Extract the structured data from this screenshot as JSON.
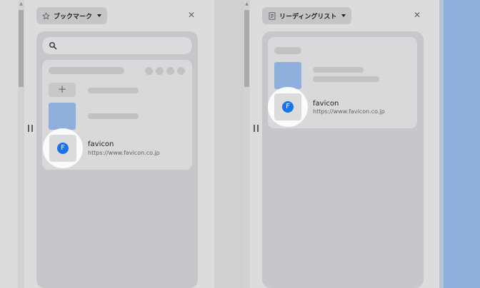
{
  "left_panel": {
    "dropdown_label": "ブックマーク",
    "close_glyph": "✕",
    "add_glyph": "+",
    "favicon_letter": "F",
    "item_title": "favicon",
    "item_url": "https://www.favicon.co.jp"
  },
  "right_panel": {
    "dropdown_label": "リーディングリスト",
    "close_glyph": "✕",
    "favicon_letter": "F",
    "item_title": "favicon",
    "item_url": "https://www.favicon.co.jp"
  },
  "scroll_glyph": "▲",
  "colors": {
    "background": "#8fb0dc",
    "panel": "#dcdcdd",
    "favicon_blue": "#1a73e8",
    "placeholder_blue": "#8fb0dc"
  }
}
